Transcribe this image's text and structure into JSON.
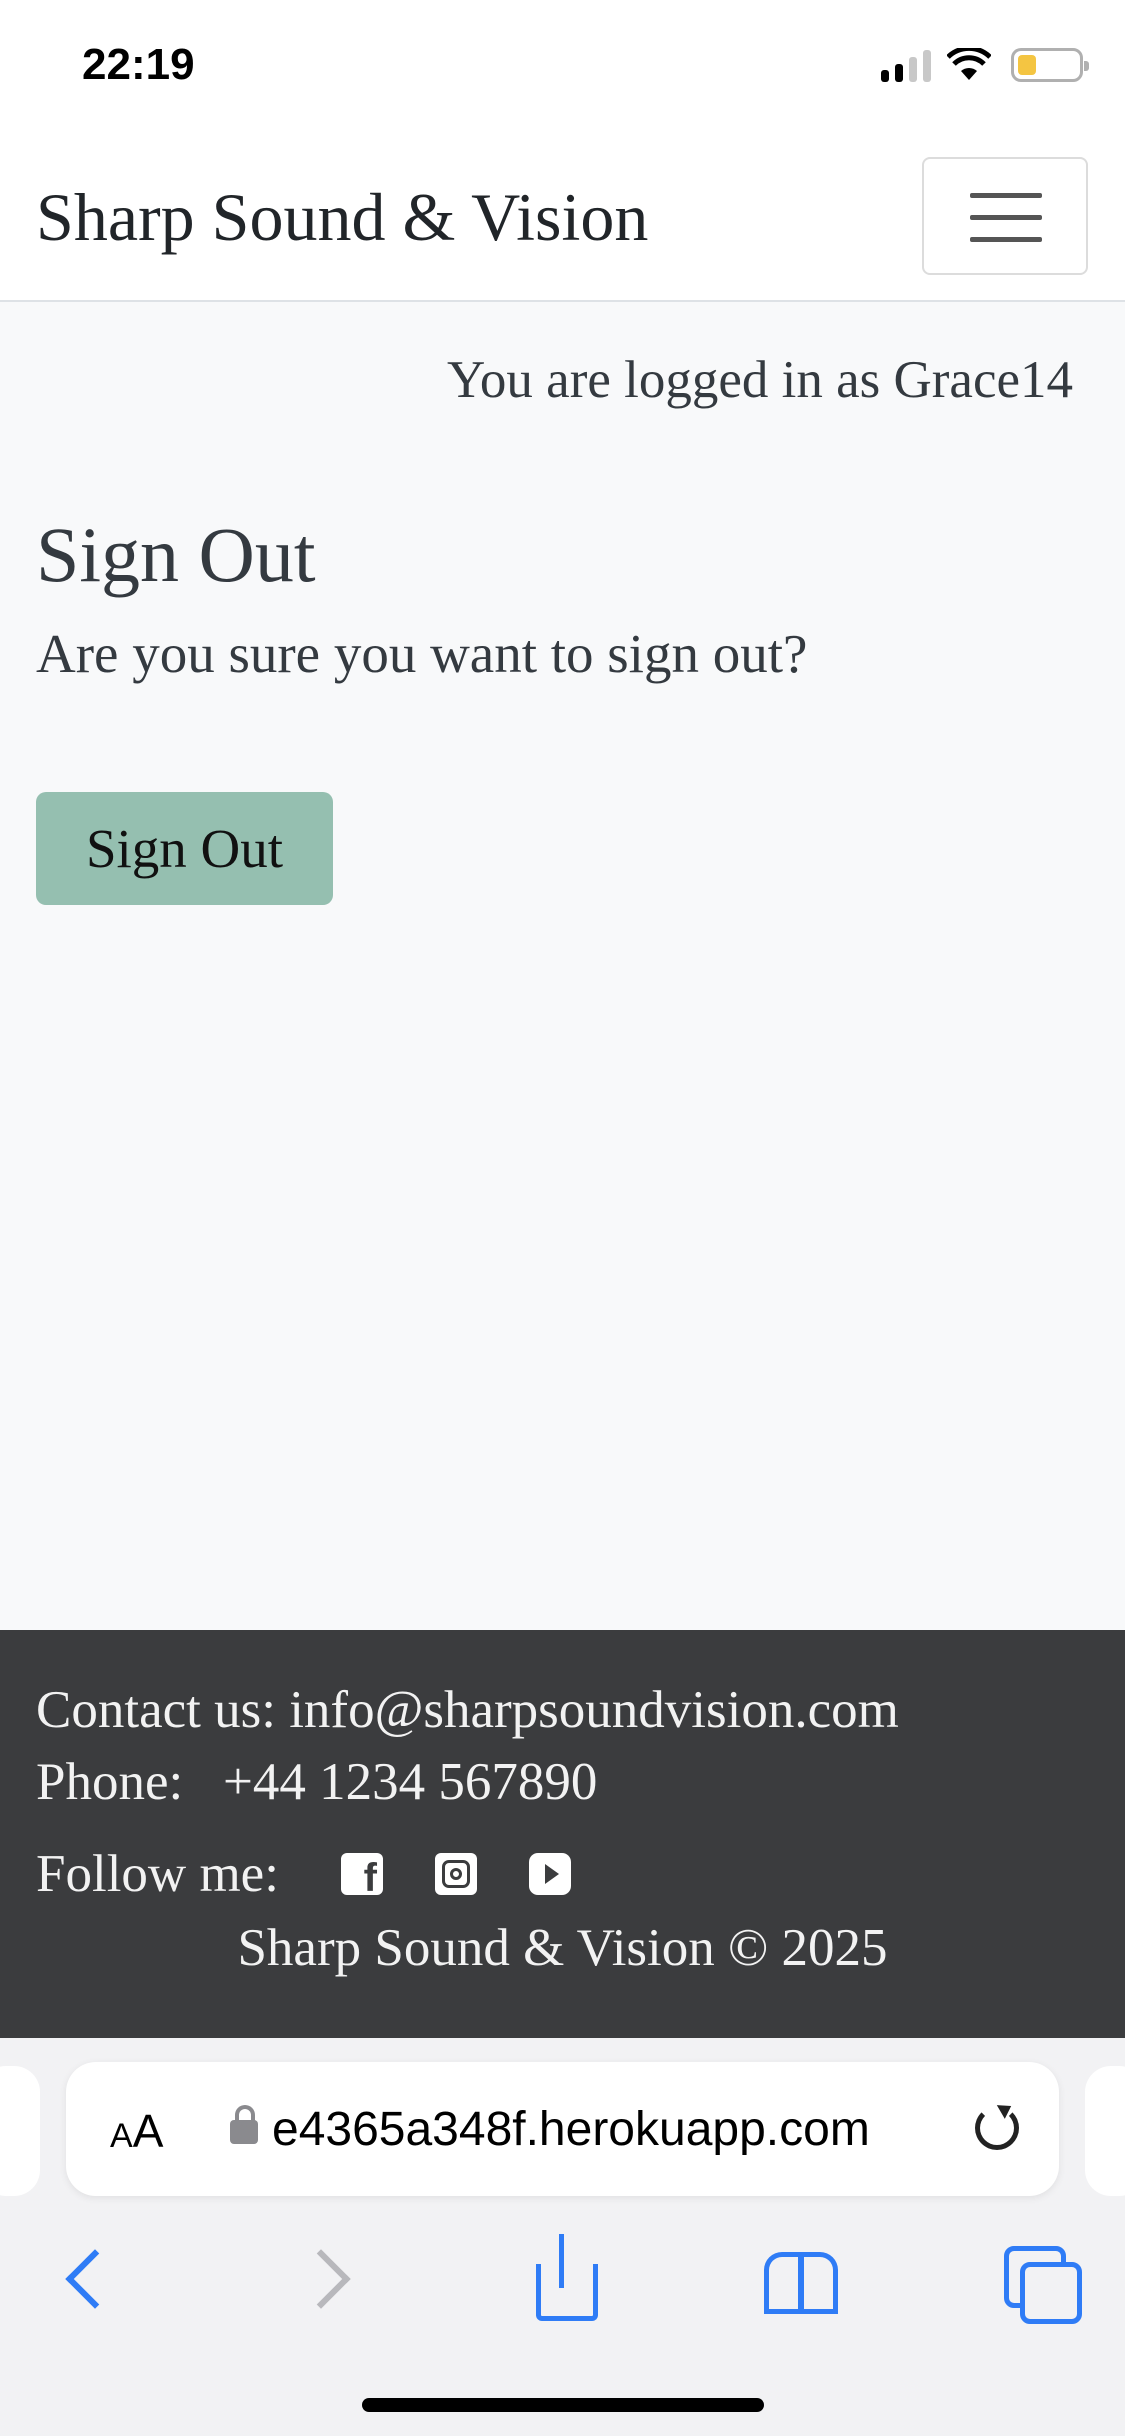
{
  "status_bar": {
    "time": "22:19"
  },
  "navbar": {
    "brand": "Sharp Sound & Vision"
  },
  "main": {
    "logged_in_text": "You are logged in as Grace14",
    "title": "Sign Out",
    "confirm_text": "Are you sure you want to sign out?",
    "signout_label": "Sign Out",
    "button_color": "#95bfb0"
  },
  "footer": {
    "contact": "Contact us: info@sharpsoundvision.com",
    "phone": "Phone:   +44 1234 567890",
    "follow": "Follow me:",
    "social_icons": [
      "facebook-icon",
      "instagram-icon",
      "youtube-icon"
    ],
    "copyright": "Sharp Sound & Vision © 2025",
    "background": "#3b3c3e"
  },
  "browser": {
    "aa_label": "AA",
    "url": "e4365a348f.herokuapp.com",
    "accent": "#2f7cf6"
  }
}
